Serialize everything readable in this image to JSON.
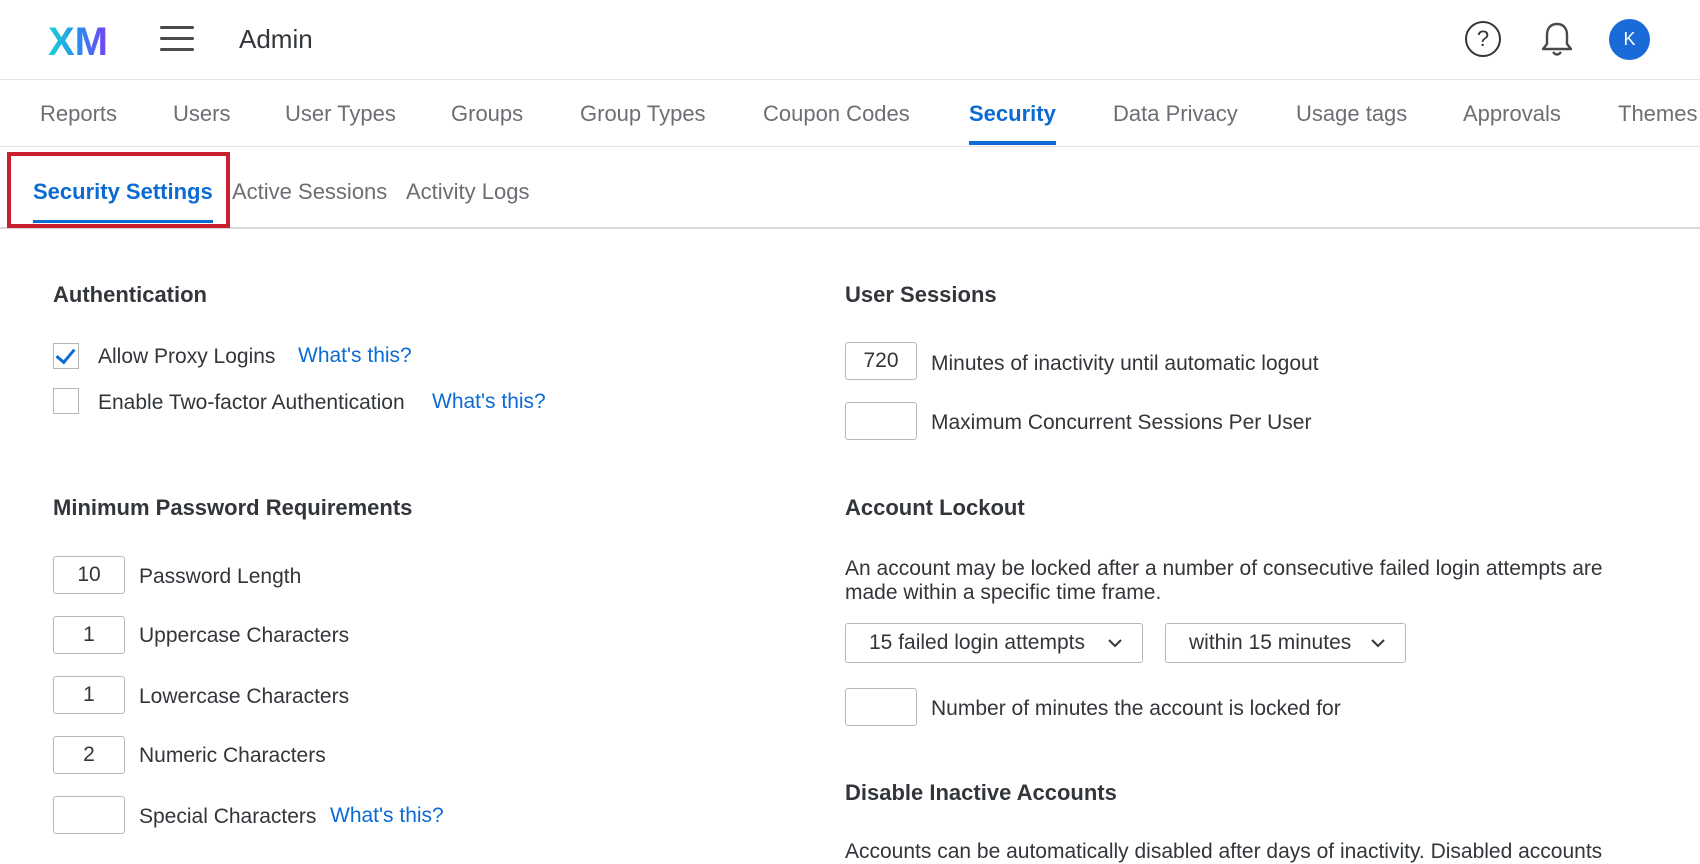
{
  "header": {
    "logo_text": "XM",
    "title": "Admin",
    "help_glyph": "?",
    "avatar_initial": "K",
    "icons": [
      "menu-icon",
      "help-icon",
      "bell-icon"
    ]
  },
  "nav": {
    "tabs": [
      "Reports",
      "Users",
      "User Types",
      "Groups",
      "Group Types",
      "Coupon Codes",
      "Security",
      "Data Privacy",
      "Usage tags",
      "Approvals",
      "Themes"
    ],
    "active": "Security"
  },
  "subnav": {
    "tabs": [
      "Security Settings",
      "Active Sessions",
      "Activity Logs"
    ],
    "active": "Security Settings"
  },
  "authentication": {
    "title": "Authentication",
    "proxy_label": "Allow Proxy Logins",
    "proxy_checked": true,
    "twofa_label": "Enable Two-factor Authentication",
    "twofa_checked": false,
    "whats_this": "What's this?"
  },
  "password": {
    "title": "Minimum Password Requirements",
    "rows": [
      {
        "value": "10",
        "label": "Password Length"
      },
      {
        "value": "1",
        "label": "Uppercase Characters"
      },
      {
        "value": "1",
        "label": "Lowercase Characters"
      },
      {
        "value": "2",
        "label": "Numeric Characters"
      },
      {
        "value": "",
        "label": "Special Characters"
      }
    ]
  },
  "sessions": {
    "title": "User Sessions",
    "inactivity_value": "720",
    "inactivity_label": "Minutes of inactivity until automatic logout",
    "concurrent_value": "",
    "concurrent_label": "Maximum Concurrent Sessions Per User"
  },
  "lockout": {
    "title": "Account Lockout",
    "description": "An account may be locked after a number of consecutive failed login attempts are made within a specific time frame.",
    "attempts_selected": "15 failed login attempts",
    "window_selected": "within 15 minutes",
    "minutes_value": "",
    "minutes_label": "Number of minutes the account is locked for"
  },
  "inactive": {
    "title": "Disable Inactive Accounts",
    "description": "Accounts can be automatically disabled after days of inactivity. Disabled accounts"
  },
  "colors": {
    "accent": "#0b6bd3",
    "highlight": "#c8202f",
    "text": "#32363a",
    "muted": "#6b6f73"
  }
}
